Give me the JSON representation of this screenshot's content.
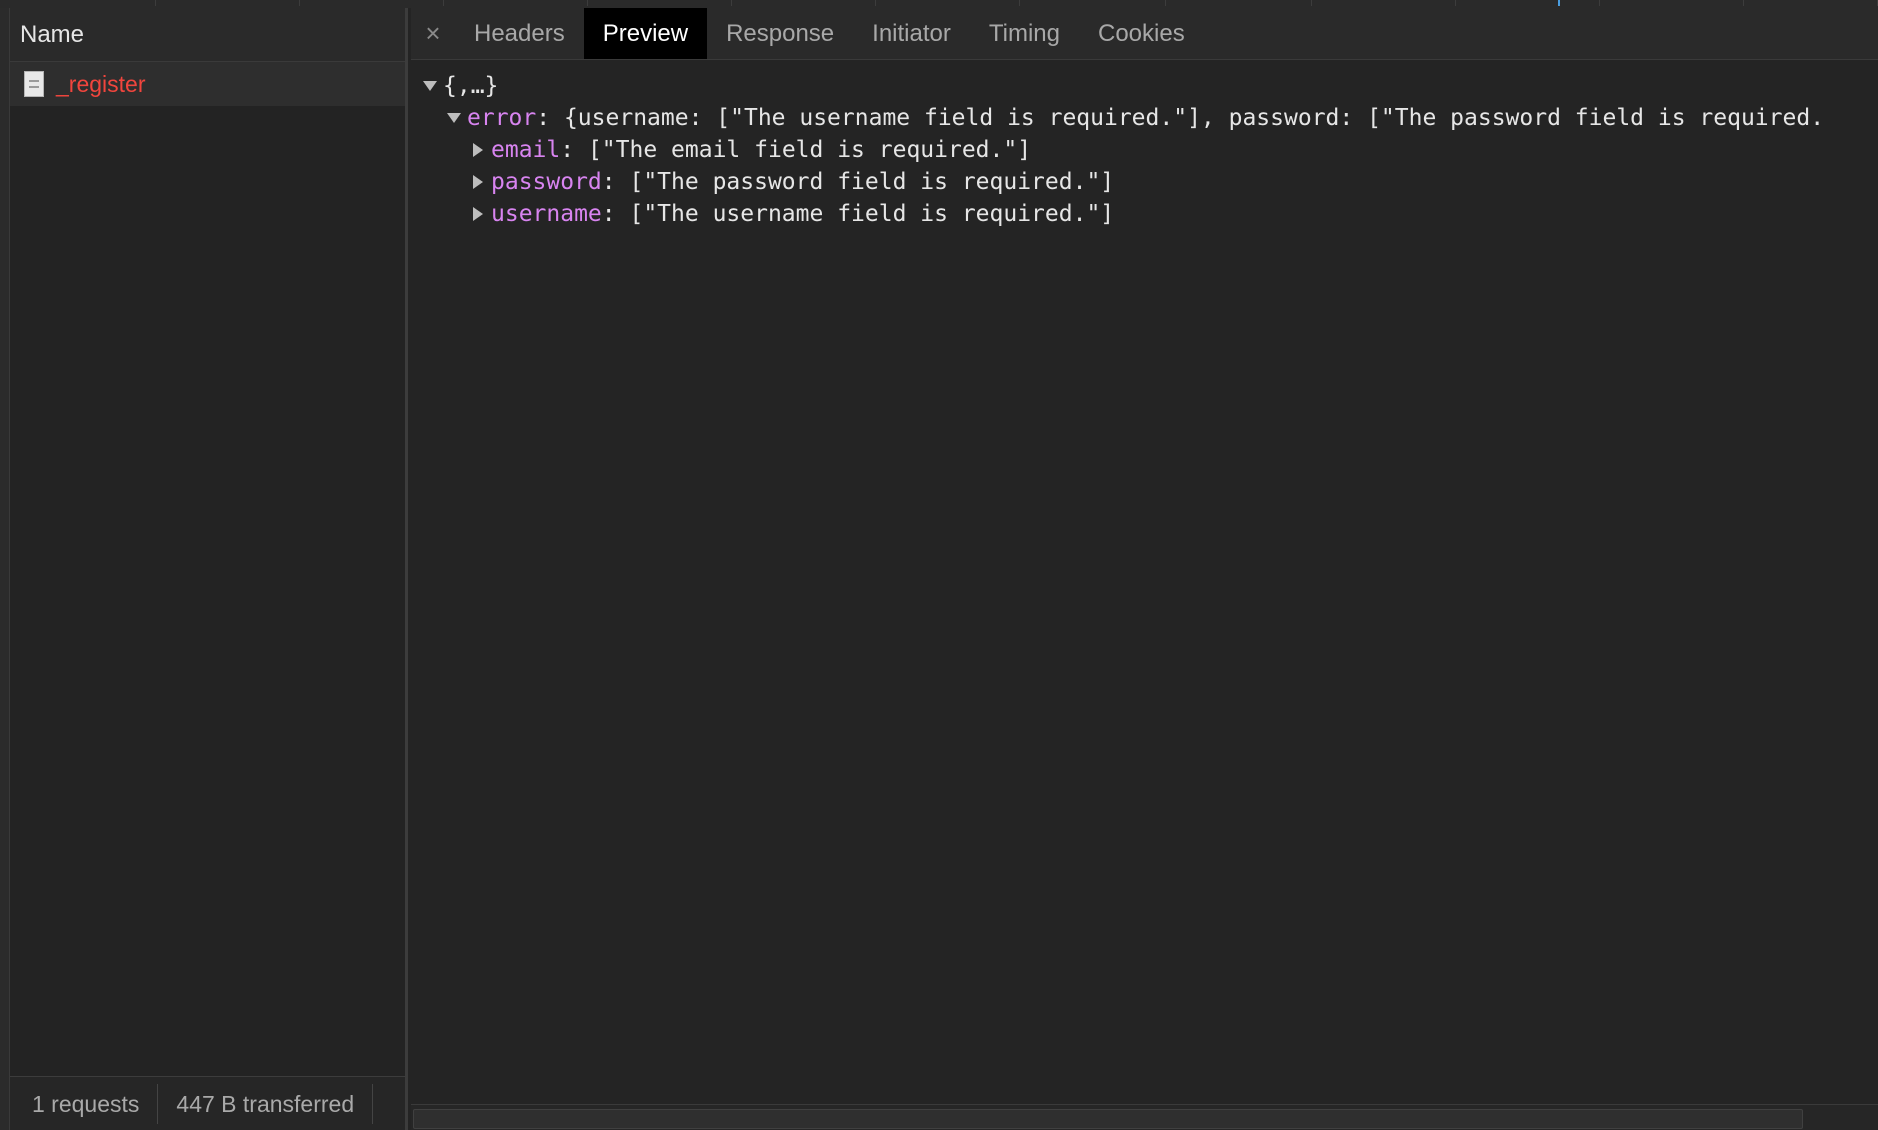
{
  "requests_panel": {
    "column_header": "Name",
    "requests": [
      {
        "name": "_register",
        "icon": "document-icon",
        "status_color": "#f1453d"
      }
    ],
    "status": {
      "count": "1 requests",
      "transferred": "447 B transferred"
    }
  },
  "detail_panel": {
    "close_label": "×",
    "tabs": [
      {
        "label": "Headers",
        "active": false
      },
      {
        "label": "Preview",
        "active": true
      },
      {
        "label": "Response",
        "active": false
      },
      {
        "label": "Initiator",
        "active": false
      },
      {
        "label": "Timing",
        "active": false
      },
      {
        "label": "Cookies",
        "active": false
      }
    ],
    "preview": {
      "root": "{,…}",
      "error_key": "error",
      "error_summary": "{username: [\"The username field is required.\"], password: [\"The password field is required.",
      "fields": [
        {
          "key": "email",
          "value": "[\"The email field is required.\"]"
        },
        {
          "key": "password",
          "value": "[\"The password field is required.\"]"
        },
        {
          "key": "username",
          "value": "[\"The username field is required.\"]"
        }
      ]
    }
  },
  "colors": {
    "key_color": "#d884f0",
    "error_request": "#f1453d",
    "active_tab_bg": "#000000"
  }
}
